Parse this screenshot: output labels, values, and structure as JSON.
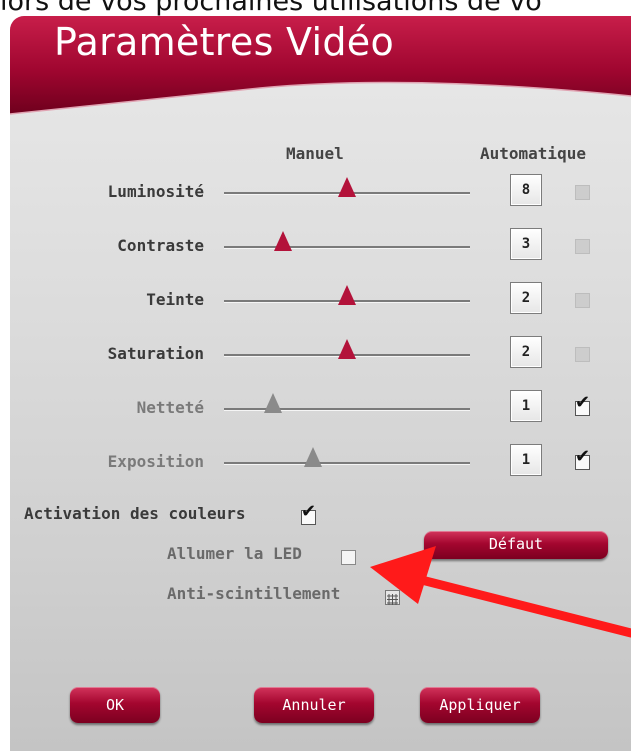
{
  "background": {
    "text": "lors de vos prochaines utilisations de vo"
  },
  "dialog": {
    "title": "Paramètres Vidéo",
    "columns": {
      "manual": "Manuel",
      "automatic": "Automatique"
    },
    "rows": [
      {
        "label": "Luminosité",
        "value": "8",
        "slider_level": 0.5,
        "auto": false,
        "enabled": true
      },
      {
        "label": "Contraste",
        "value": "3",
        "slider_level": 0.24,
        "auto": false,
        "enabled": true
      },
      {
        "label": "Teinte",
        "value": "2",
        "slider_level": 0.5,
        "auto": false,
        "enabled": true
      },
      {
        "label": "Saturation",
        "value": "2",
        "slider_level": 0.5,
        "auto": false,
        "enabled": true
      },
      {
        "label": "Netteté",
        "value": "1",
        "slider_level": 0.2,
        "auto": true,
        "enabled": false
      },
      {
        "label": "Exposition",
        "value": "1",
        "slider_level": 0.36,
        "auto": true,
        "enabled": false
      }
    ],
    "options": {
      "colors": {
        "label": "Activation des couleurs",
        "checked": true
      },
      "led": {
        "label": "Allumer la LED",
        "checked": false
      },
      "antiflicker": {
        "label": "Anti-scintillement",
        "icon": "grid-icon"
      }
    },
    "buttons": {
      "default": "Défaut",
      "ok": "OK",
      "cancel": "Annuler",
      "apply": "Appliquer"
    }
  },
  "colors": {
    "accent": "#a4062f",
    "thumb": "#b3123a",
    "annotation_arrow": "#ff1a1a"
  }
}
